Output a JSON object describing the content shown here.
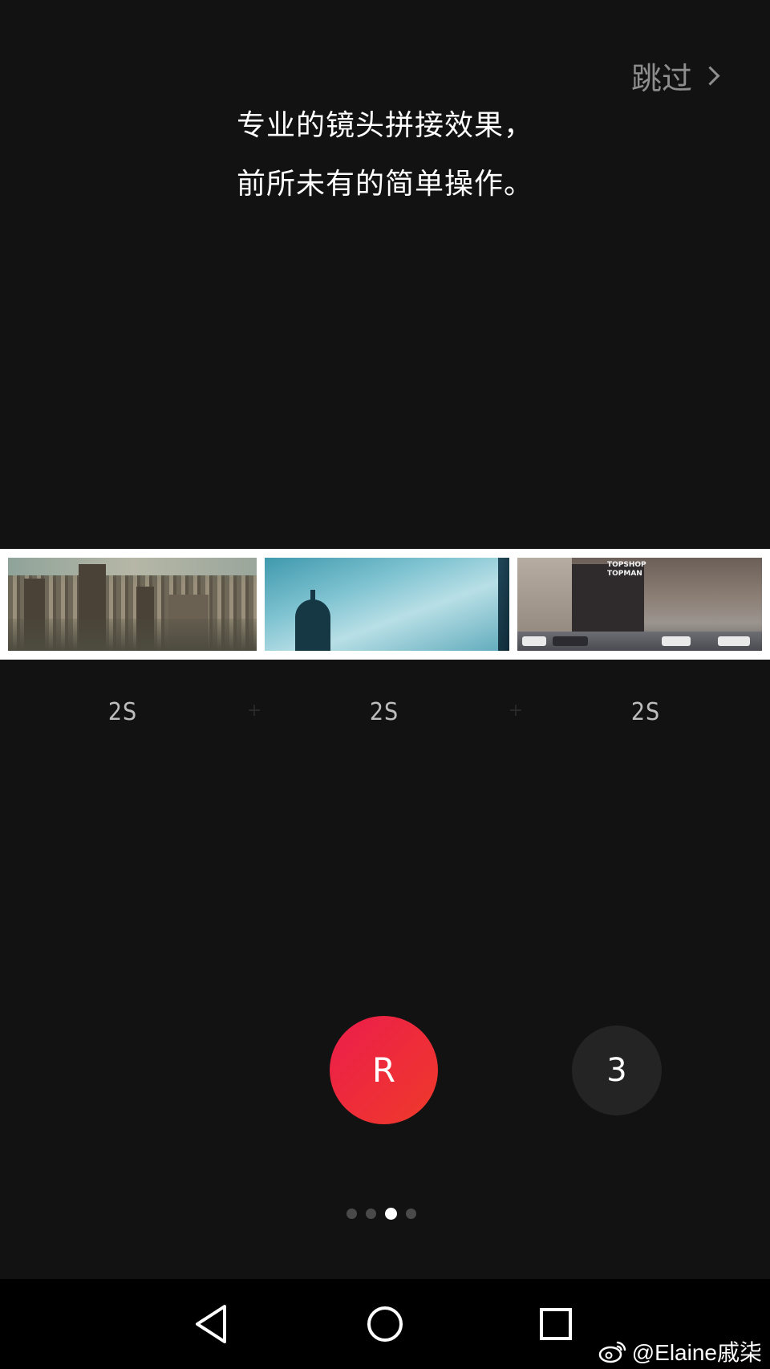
{
  "header": {
    "skip_label": "跳过"
  },
  "intro": {
    "line1": "专业的镜头拼接效果，",
    "line2": "前所未有的简单操作。"
  },
  "filmstrip": {
    "clips": [
      {
        "duration": "2S",
        "scene": "castle rooftops"
      },
      {
        "duration": "2S",
        "scene": "dome against sky"
      },
      {
        "duration": "2S",
        "scene": "street with storefront"
      }
    ],
    "storefront_sign": [
      "TOPSHOP",
      "TOPMAN"
    ],
    "joiner": "+"
  },
  "controls": {
    "record_label": "R",
    "clip_count": "3",
    "accent_color": "#ec1d4b"
  },
  "pager": {
    "total": 4,
    "active_index": 2
  },
  "system_nav": {
    "icons": [
      "back-icon",
      "home-icon",
      "recents-icon"
    ]
  },
  "watermark": {
    "text": "@Elaine戚柒"
  }
}
